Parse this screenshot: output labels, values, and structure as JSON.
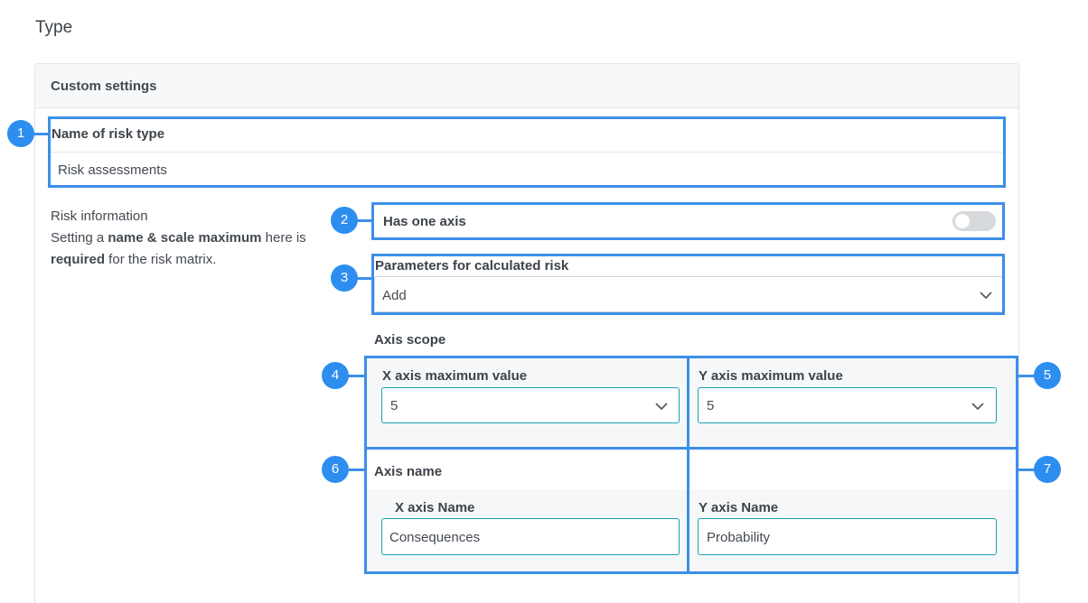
{
  "page": {
    "title": "Type"
  },
  "panel": {
    "title": "Custom settings"
  },
  "risk_type": {
    "label": "Name of risk type",
    "value": "Risk assessments"
  },
  "info": {
    "line1": "Risk information",
    "line2_parts": [
      "Setting a ",
      "name & scale maximum",
      " here is ",
      "required",
      " for the risk matrix."
    ]
  },
  "one_axis": {
    "label": "Has one axis",
    "enabled": false
  },
  "parameters": {
    "label": "Parameters for calculated risk",
    "value": "Add"
  },
  "axis_scope": {
    "heading": "Axis scope"
  },
  "x_max": {
    "label": "X axis maximum value",
    "value": "5"
  },
  "y_max": {
    "label": "Y axis maximum value",
    "value": "5"
  },
  "axis_name": {
    "heading": "Axis name"
  },
  "x_name": {
    "label": "X axis Name",
    "value": "Consequences"
  },
  "y_name": {
    "label": "Y axis Name",
    "value": "Probability"
  },
  "callouts": [
    "1",
    "2",
    "3",
    "4",
    "5",
    "6",
    "7"
  ],
  "colors": {
    "highlight": "#3d8fe8",
    "badge": "#2e8ef0",
    "focus_border": "#19a0b0"
  }
}
